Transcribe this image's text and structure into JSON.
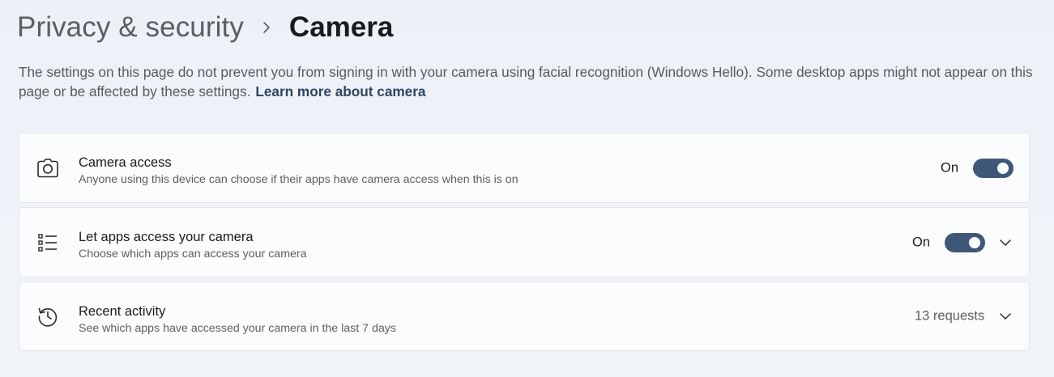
{
  "breadcrumb": {
    "parent": "Privacy & security",
    "current": "Camera"
  },
  "description": {
    "text": "The settings on this page do not prevent you from signing in with your camera using facial recognition (Windows Hello). Some desktop apps might not appear on this page or be affected by these settings.",
    "link": "Learn more about camera"
  },
  "cards": {
    "camera_access": {
      "icon": "camera-icon",
      "title": "Camera access",
      "subtitle": "Anyone using this device can choose if their apps have camera access when this is on",
      "state": "On",
      "toggle_on": true
    },
    "let_apps": {
      "icon": "list-icon",
      "title": "Let apps access your camera",
      "subtitle": "Choose which apps can access your camera",
      "state": "On",
      "toggle_on": true
    },
    "recent_activity": {
      "icon": "history-icon",
      "title": "Recent activity",
      "subtitle": "See which apps have accessed your camera in the last 7 days",
      "requests": "13 requests"
    }
  },
  "colors": {
    "accent": "#3f5878",
    "link": "#2d4560",
    "background": "#eef2f8",
    "card": "#fbfcfd"
  }
}
